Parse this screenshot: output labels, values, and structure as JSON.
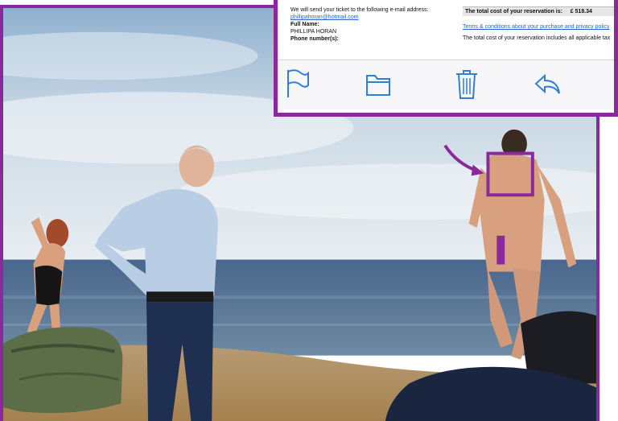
{
  "email": {
    "send_line": "We will send your ticket to the following e-mail address:",
    "email_address": "phillipahoran@hotmail.com",
    "full_name_label": "Full Name:",
    "full_name_value": "PHILLIPA HORAN",
    "phone_label": "Phone number(s):",
    "cost_label": "The total cost of your reservation is:",
    "cost_value": "£ 518.34",
    "terms_link": "Terms & conditions about your purchase and privacy policy",
    "taxes_line": "The total cost of your reservation includes all applicable tax"
  },
  "toolbar": {
    "icons": [
      "flag-icon",
      "folder-icon",
      "trash-icon",
      "reply-icon"
    ]
  },
  "colors": {
    "frame": "#8a2a9a",
    "icon": "#2f7fd6",
    "sky_top": "#9fb9d4",
    "sea": "#3f5d82",
    "sand": "#b8966a"
  }
}
